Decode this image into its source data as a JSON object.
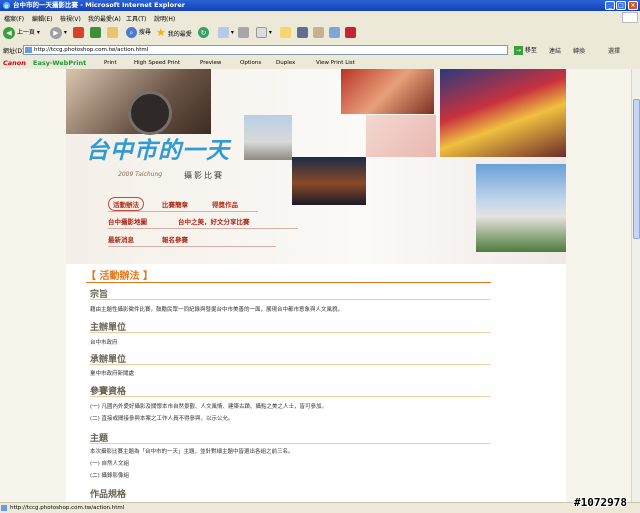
{
  "window": {
    "title": "台中市的一天攝影比賽 - Microsoft Internet Explorer"
  },
  "menu": [
    "檔案(F)",
    "編輯(E)",
    "檢視(V)",
    "我的最愛(A)",
    "工具(T)",
    "說明(H)"
  ],
  "toolbar": {
    "back": "上一頁",
    "search": "搜尋",
    "favorites": "我的最愛"
  },
  "address": {
    "label": "網址(D)",
    "url": "http://tccg.photoshop.com.tw/action.html",
    "go": "移至",
    "links": "連結",
    "translate": "轉換",
    "select": "選擇"
  },
  "printbar": {
    "brand": "Canon",
    "product": "Easy-WebPrint",
    "print": "Print",
    "high_speed": "High Speed Print",
    "preview": "Preview",
    "options": "Options",
    "duplex": "Duplex",
    "view_list": "View Print List"
  },
  "header": {
    "logo": "台中市的一天",
    "year": "2009 Taichung",
    "subtitle": "攝影比賽"
  },
  "nav": [
    "活動辦法",
    "比賽簡章",
    "得獎作品",
    "台中攝影地圖",
    "台中之美，好文分享比賽",
    "最新消息",
    "報名參賽"
  ],
  "content": {
    "title": "【 活動辦法 】",
    "sections": [
      {
        "heading": "宗旨",
        "lines": [
          "藉由主題性攝影徵件比賽，鼓勵民眾一同紀錄與發掘台中市美善的一面，展現台中都市意象與人文風貌。"
        ]
      },
      {
        "heading": "主辦單位",
        "lines": [
          "台中市政府"
        ]
      },
      {
        "heading": "承辦單位",
        "lines": [
          "臺中市政府新聞處"
        ]
      },
      {
        "heading": "參賽資格",
        "lines": [
          "(一) 凡國內外愛好攝影及關懷本市自然景觀、人文風情、建築古蹟、攝點之美之人士，皆可參加。",
          "(二) 直接或間接參與本案之工作人員不得參與，以示公允。"
        ]
      },
      {
        "heading": "主題",
        "lines": [
          "本次攝影比賽主題為「台中市的一天」主題，並針對細主題中皆選出各組之前三名。",
          "(一) 自然人文組",
          "(二) 攝錄影像組"
        ]
      },
      {
        "heading": "作品規格",
        "lines": []
      }
    ]
  },
  "status": {
    "url": "http://tccg.photoshop.com.tw/action.html"
  },
  "watermark": "#1072978"
}
